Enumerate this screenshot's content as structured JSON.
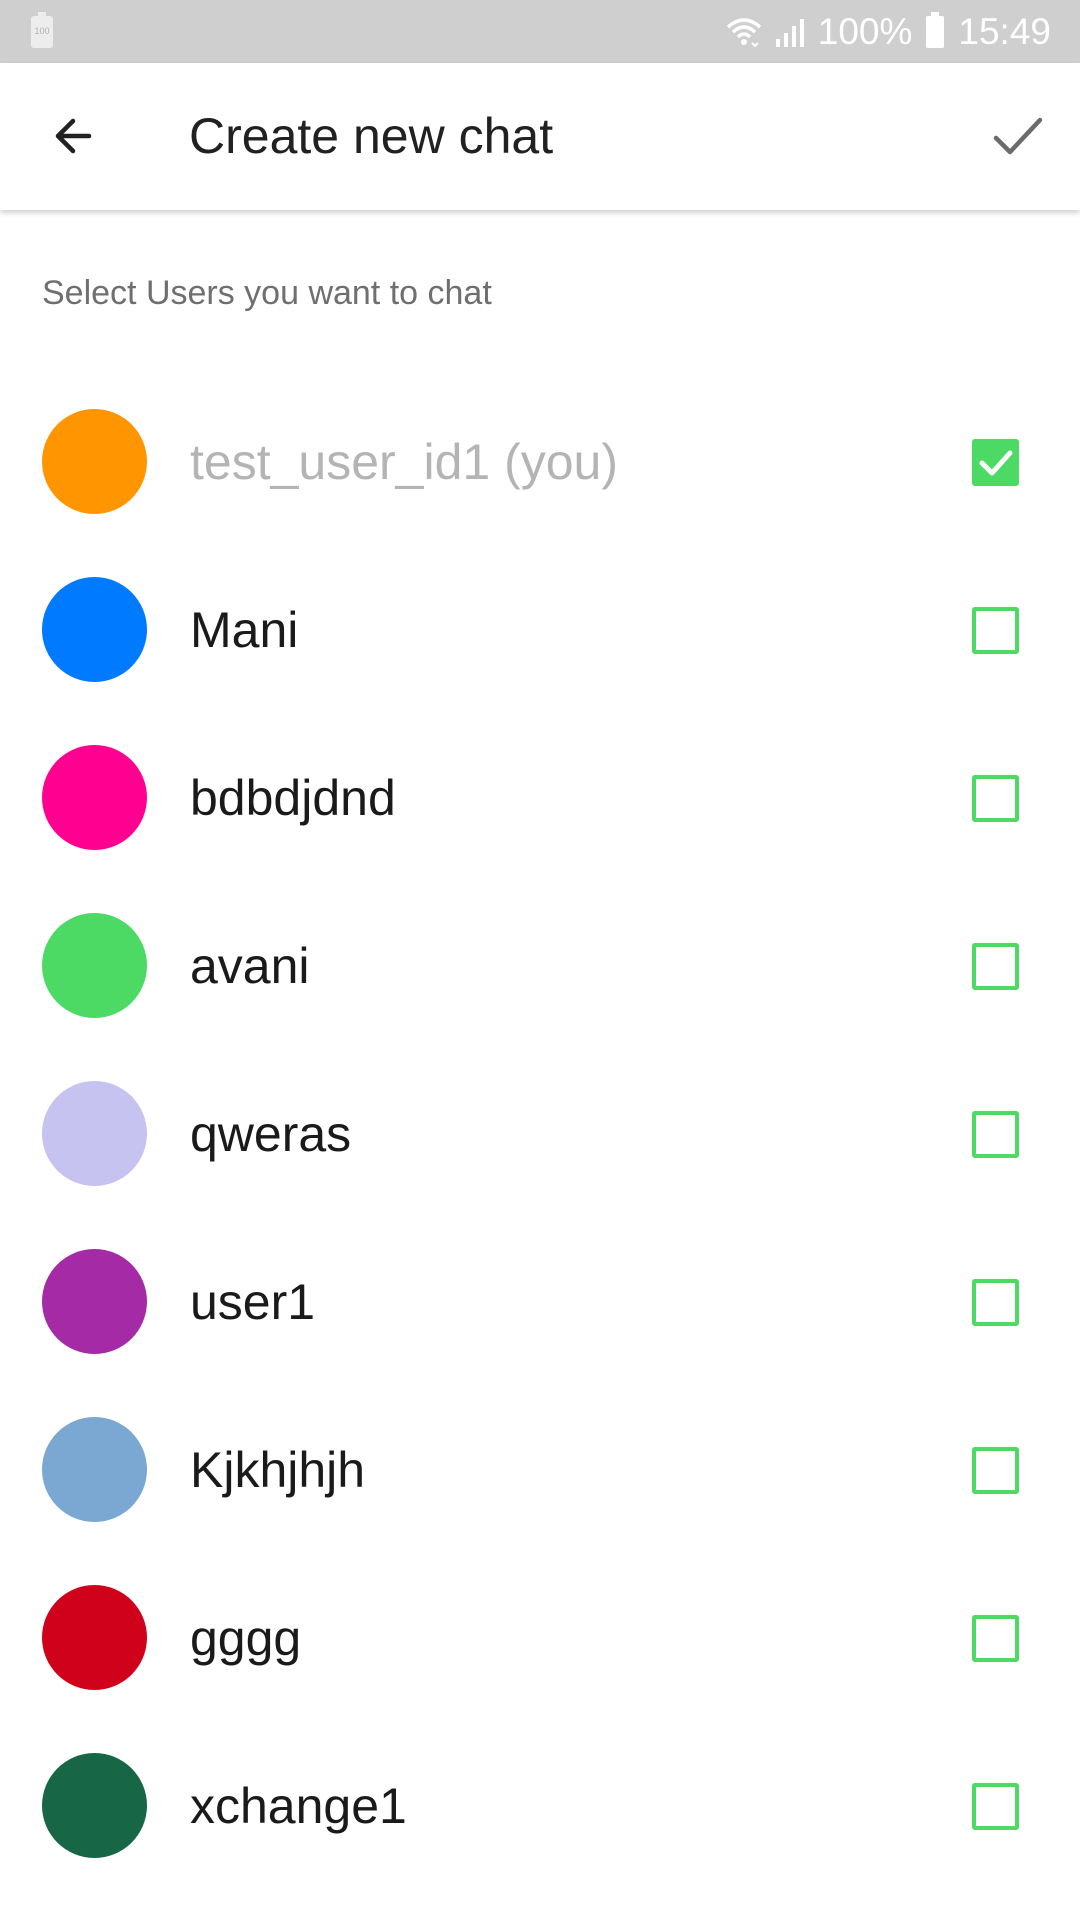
{
  "status_bar": {
    "left_battery_label": "100",
    "battery_percent": "100%",
    "time": "15:49"
  },
  "app_bar": {
    "title": "Create new chat",
    "back_icon": "arrow-back-icon",
    "confirm_icon": "check-icon"
  },
  "subtitle": "Select Users you want to chat",
  "users": [
    {
      "name": "test_user_id1 (you)",
      "avatar_color": "#ff9500",
      "checked": true,
      "is_self": true
    },
    {
      "name": "Mani",
      "avatar_color": "#007aff",
      "checked": false,
      "is_self": false
    },
    {
      "name": "bdbdjdnd",
      "avatar_color": "#ff0090",
      "checked": false,
      "is_self": false
    },
    {
      "name": "avani",
      "avatar_color": "#4cd964",
      "checked": false,
      "is_self": false
    },
    {
      "name": "qweras",
      "avatar_color": "#c6c3f0",
      "checked": false,
      "is_self": false
    },
    {
      "name": "user1",
      "avatar_color": "#a52aa5",
      "checked": false,
      "is_self": false
    },
    {
      "name": "Kjkhjhjh",
      "avatar_color": "#7aa8d2",
      "checked": false,
      "is_self": false
    },
    {
      "name": "gggg",
      "avatar_color": "#d0021b",
      "checked": false,
      "is_self": false
    },
    {
      "name": "xchange1",
      "avatar_color": "#176645",
      "checked": false,
      "is_self": false
    }
  ],
  "colors": {
    "checkbox_green": "#4cd964",
    "status_bar_bg": "#cfcfcf"
  }
}
